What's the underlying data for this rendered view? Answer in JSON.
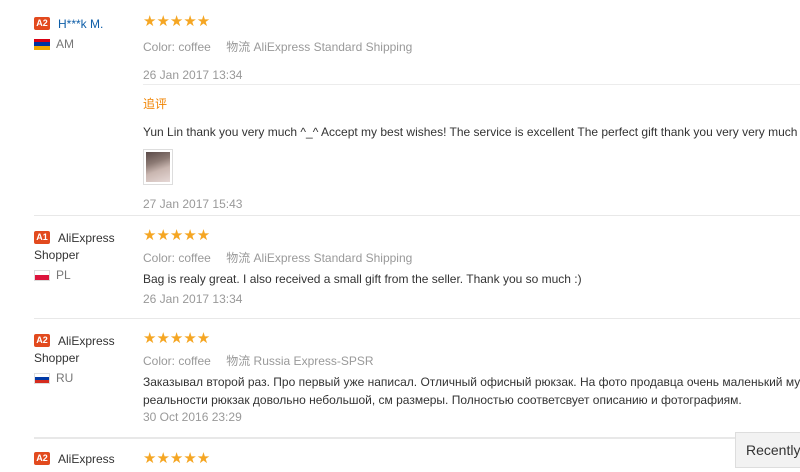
{
  "reviews": [
    {
      "badge": "A2",
      "name": "H***k M.",
      "country": "AM",
      "stars": "★★★★★",
      "color_label": "Color:",
      "color_value": "coffee",
      "shipping_label": "物流",
      "shipping_value": "AliExpress Standard Shipping",
      "date": "26 Jan 2017 13:34",
      "additional": {
        "label": "追评",
        "text": "Yun Lin thank you very much ^_^ Accept my best wishes! The service is excellent The perfect gift thank you very very much",
        "date": "27 Jan 2017 15:43"
      }
    },
    {
      "badge": "A1",
      "name_line1": "AliExpress",
      "name_line2": "Shopper",
      "country": "PL",
      "stars": "★★★★★",
      "color_label": "Color:",
      "color_value": "coffee",
      "shipping_label": "物流",
      "shipping_value": "AliExpress Standard Shipping",
      "text": "Bag is realy great. I also received a small gift from the seller. Thank you so much :)",
      "date": "26 Jan 2017 13:34"
    },
    {
      "badge": "A2",
      "name_line1": "AliExpress",
      "name_line2": "Shopper",
      "country": "RU",
      "stars": "★★★★★",
      "color_label": "Color:",
      "color_value": "coffee",
      "shipping_label": "物流",
      "shipping_value": "Russia Express-SPSR",
      "text_line1": "Заказывал второй раз. Про первый уже написал. Отличный офисный рюкзак. На фото продавца очень маленький му",
      "text_line2": "реальности рюкзак довольно небольшой, см размеры. Полностью соответсвует описанию и фотографиям.",
      "date": "30 Oct 2016 23:29"
    },
    {
      "badge": "A2",
      "name_line1": "AliExpress",
      "stars": "★★★★★"
    }
  ],
  "recently_viewed": "Recently V",
  "colors": {
    "badge": "#e24a1e",
    "stars": "#f5a623",
    "link": "#0e5ea8",
    "additional": "#f08300"
  }
}
